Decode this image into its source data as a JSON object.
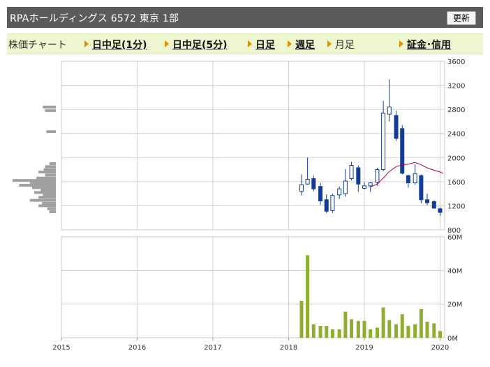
{
  "header": {
    "title": "RPAホールディングス  6572  東京 1部",
    "refresh_label": "更新"
  },
  "tabs": {
    "label": "株価チャート",
    "items": [
      {
        "label": "日中足(1分)",
        "link": true
      },
      {
        "label": "日中足(5分)",
        "link": true
      },
      {
        "label": "日足",
        "link": true
      },
      {
        "label": "週足",
        "link": true
      },
      {
        "label": "月足",
        "link": false
      },
      {
        "label": "証金･信用",
        "link": true
      }
    ]
  },
  "chart_data": [
    {
      "type": "candlestick",
      "title": "",
      "y_ticks": [
        "3600",
        "3200",
        "2800",
        "2400",
        "2000",
        "1600",
        "1200",
        "800"
      ],
      "ylim": [
        800,
        3600
      ],
      "x_ticks": [
        "2015",
        "2016",
        "2017",
        "2018",
        "2019",
        "2020"
      ],
      "xlim": [
        2015.0,
        2020.06
      ],
      "grid": true,
      "colors": {
        "up": "#ffffff",
        "down": "#103c96",
        "outline": "#103c96",
        "ma": "#b00040",
        "grid": "#d0d0d0",
        "volume_profile": "#a0a0a0",
        "volume": "#8fad2e"
      },
      "candles": [
        {
          "t": 2018.17,
          "o": 1440,
          "h": 1720,
          "l": 1370,
          "c": 1550
        },
        {
          "t": 2018.25,
          "o": 1560,
          "h": 2000,
          "l": 1550,
          "c": 1640
        },
        {
          "t": 2018.33,
          "o": 1650,
          "h": 1700,
          "l": 1440,
          "c": 1480
        },
        {
          "t": 2018.42,
          "o": 1520,
          "h": 1580,
          "l": 1220,
          "c": 1280
        },
        {
          "t": 2018.5,
          "o": 1300,
          "h": 1390,
          "l": 1080,
          "c": 1110
        },
        {
          "t": 2018.58,
          "o": 1120,
          "h": 1400,
          "l": 1080,
          "c": 1370
        },
        {
          "t": 2018.67,
          "o": 1380,
          "h": 1520,
          "l": 1310,
          "c": 1480
        },
        {
          "t": 2018.75,
          "o": 1400,
          "h": 1810,
          "l": 1350,
          "c": 1610
        },
        {
          "t": 2018.83,
          "o": 1650,
          "h": 1930,
          "l": 1620,
          "c": 1870
        },
        {
          "t": 2018.92,
          "o": 1830,
          "h": 1870,
          "l": 1430,
          "c": 1560
        },
        {
          "t": 2019.0,
          "o": 1490,
          "h": 1590,
          "l": 1470,
          "c": 1530
        },
        {
          "t": 2019.08,
          "o": 1530,
          "h": 1590,
          "l": 1430,
          "c": 1580
        },
        {
          "t": 2019.17,
          "o": 1590,
          "h": 1830,
          "l": 1530,
          "c": 1800
        },
        {
          "t": 2019.25,
          "o": 1800,
          "h": 2940,
          "l": 1770,
          "c": 2740
        },
        {
          "t": 2019.33,
          "o": 2720,
          "h": 3300,
          "l": 2600,
          "c": 2840
        },
        {
          "t": 2019.42,
          "o": 2700,
          "h": 2780,
          "l": 2280,
          "c": 2320
        },
        {
          "t": 2019.5,
          "o": 2480,
          "h": 2540,
          "l": 1720,
          "c": 1740
        },
        {
          "t": 2019.58,
          "o": 1700,
          "h": 1720,
          "l": 1500,
          "c": 1580
        },
        {
          "t": 2019.67,
          "o": 1580,
          "h": 1890,
          "l": 1550,
          "c": 1730
        },
        {
          "t": 2019.75,
          "o": 1700,
          "h": 1720,
          "l": 1240,
          "c": 1300
        },
        {
          "t": 2019.83,
          "o": 1300,
          "h": 1400,
          "l": 1210,
          "c": 1250
        },
        {
          "t": 2019.92,
          "o": 1270,
          "h": 1290,
          "l": 1150,
          "c": 1160
        },
        {
          "t": 2020.0,
          "o": 1150,
          "h": 1170,
          "l": 1030,
          "c": 1090
        }
      ],
      "moving_average": [
        {
          "t": 2019.08,
          "v": 1510
        },
        {
          "t": 2019.17,
          "v": 1560
        },
        {
          "t": 2019.25,
          "v": 1660
        },
        {
          "t": 2019.33,
          "v": 1770
        },
        {
          "t": 2019.42,
          "v": 1850
        },
        {
          "t": 2019.5,
          "v": 1880
        },
        {
          "t": 2019.58,
          "v": 1890
        },
        {
          "t": 2019.67,
          "v": 1920
        },
        {
          "t": 2019.75,
          "v": 1880
        },
        {
          "t": 2019.83,
          "v": 1830
        },
        {
          "t": 2019.92,
          "v": 1790
        },
        {
          "t": 2020.0,
          "v": 1760
        },
        {
          "t": 2020.04,
          "v": 1740
        }
      ],
      "price_volume_profile": [
        {
          "price": 2840,
          "amount": 0.3
        },
        {
          "price": 2780,
          "amount": 0.25
        },
        {
          "price": 2430,
          "amount": 0.22
        },
        {
          "price": 1900,
          "amount": 0.15
        },
        {
          "price": 1850,
          "amount": 0.25
        },
        {
          "price": 1800,
          "amount": 0.28
        },
        {
          "price": 1760,
          "amount": 0.4
        },
        {
          "price": 1710,
          "amount": 0.25
        },
        {
          "price": 1660,
          "amount": 0.45
        },
        {
          "price": 1620,
          "amount": 1.0
        },
        {
          "price": 1580,
          "amount": 0.6
        },
        {
          "price": 1540,
          "amount": 0.85
        },
        {
          "price": 1500,
          "amount": 0.55
        },
        {
          "price": 1460,
          "amount": 0.35
        },
        {
          "price": 1420,
          "amount": 0.5
        },
        {
          "price": 1380,
          "amount": 0.3
        },
        {
          "price": 1340,
          "amount": 0.4
        },
        {
          "price": 1290,
          "amount": 0.6
        },
        {
          "price": 1240,
          "amount": 0.32
        },
        {
          "price": 1200,
          "amount": 0.4
        },
        {
          "price": 1150,
          "amount": 0.2
        },
        {
          "price": 1100,
          "amount": 0.15
        }
      ]
    },
    {
      "type": "bar",
      "y_ticks": [
        "60M",
        "40M",
        "20M",
        "0M"
      ],
      "ylim": [
        0,
        60
      ],
      "units": "M",
      "x_ticks": [
        "2015",
        "2016",
        "2017",
        "2018",
        "2019",
        "2020"
      ],
      "xlim": [
        2015.0,
        2020.06
      ],
      "volumes": [
        {
          "t": 2018.17,
          "v": 22
        },
        {
          "t": 2018.25,
          "v": 49
        },
        {
          "t": 2018.33,
          "v": 8
        },
        {
          "t": 2018.42,
          "v": 7
        },
        {
          "t": 2018.5,
          "v": 7
        },
        {
          "t": 2018.58,
          "v": 5
        },
        {
          "t": 2018.67,
          "v": 5
        },
        {
          "t": 2018.75,
          "v": 15.5
        },
        {
          "t": 2018.83,
          "v": 11
        },
        {
          "t": 2018.92,
          "v": 10
        },
        {
          "t": 2019.0,
          "v": 10
        },
        {
          "t": 2019.08,
          "v": 5
        },
        {
          "t": 2019.17,
          "v": 6
        },
        {
          "t": 2019.25,
          "v": 18
        },
        {
          "t": 2019.33,
          "v": 10.5
        },
        {
          "t": 2019.42,
          "v": 8
        },
        {
          "t": 2019.5,
          "v": 14
        },
        {
          "t": 2019.58,
          "v": 7
        },
        {
          "t": 2019.67,
          "v": 8
        },
        {
          "t": 2019.75,
          "v": 17
        },
        {
          "t": 2019.83,
          "v": 9.5
        },
        {
          "t": 2019.92,
          "v": 8.5
        },
        {
          "t": 2020.0,
          "v": 4
        }
      ]
    }
  ]
}
